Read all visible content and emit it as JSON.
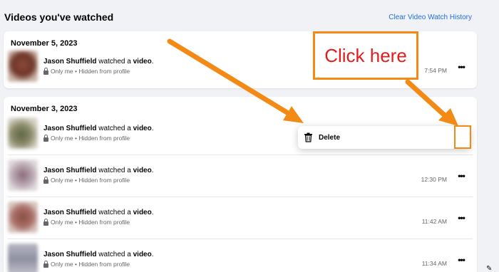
{
  "header": {
    "title": "Videos you've watched",
    "clear_link": "Clear Video Watch History"
  },
  "sections": [
    {
      "date": "November 5, 2023",
      "rows": [
        {
          "name": "Jason Shuffield",
          "watched": "watched a",
          "object": "video",
          "period": ".",
          "privacy": "Only me • Hidden from profile",
          "time": "7:54 PM"
        }
      ]
    },
    {
      "date": "November 3, 2023",
      "rows": [
        {
          "name": "Jason Shuffield",
          "watched": "watched a",
          "object": "video",
          "period": ".",
          "privacy": "Only me • Hidden from profile",
          "time": ""
        },
        {
          "name": "Jason Shuffield",
          "watched": "watched a",
          "object": "video",
          "period": ".",
          "privacy": "Only me • Hidden from profile",
          "time": "12:30 PM"
        },
        {
          "name": "Jason Shuffield",
          "watched": "watched a",
          "object": "video",
          "period": ".",
          "privacy": "Only me • Hidden from profile",
          "time": "11:42 AM"
        },
        {
          "name": "Jason Shuffield",
          "watched": "watched a",
          "object": "video",
          "period": ".",
          "privacy": "Only me • Hidden from profile",
          "time": "11:34 AM"
        }
      ]
    }
  ],
  "more_button": "•••",
  "menu": {
    "delete_label": "Delete",
    "icon": "trash-icon"
  },
  "callout": {
    "text": "Click here"
  },
  "colors": {
    "accent_link": "#216fdb",
    "annotation_orange": "#f48a16",
    "callout_text": "#e31d1d",
    "page_bg": "#f0f2f5"
  }
}
